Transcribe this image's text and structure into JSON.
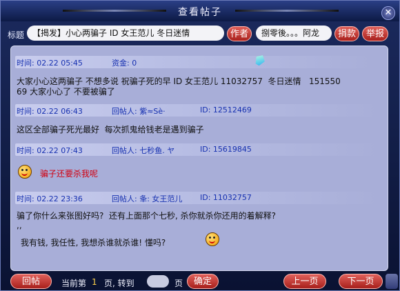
{
  "window": {
    "title": "查看帖子"
  },
  "header": {
    "title_label": "标题",
    "post_title": "【揭发】小心两骗子 ID 女王范儿  冬日迷情",
    "author_button": "作者",
    "author_name": "捌零後。。。阿龙",
    "donate_button": "捐款",
    "report_button": "举报"
  },
  "posts": [
    {
      "meta_time": "时间: 02.22 05:45",
      "meta_funds": "资金: 0",
      "lines": [
        "大家小心这两骗子 不想多说 祝骗子死的早 ID 女王范儿 11032757  冬日迷情   151550",
        "69 大家小心了 不要被骗了"
      ]
    },
    {
      "meta_time": "时间: 02.22 06:43",
      "meta_replier": "回帖人: 紫≈Sè·",
      "meta_id": "ID: 12512469",
      "lines": [
        "这区全部骗子死光最好  每次抓鬼给钱老是遇到骗子"
      ]
    },
    {
      "meta_time": "时间: 02.22 07:43",
      "meta_replier": "回帖人: 七秒鱼. ヤ",
      "meta_id": "ID: 15619845",
      "lines": [
        "骗子还要杀我呢"
      ]
    },
    {
      "meta_time": "时间: 02.22 23:36",
      "meta_replier": "回帖人: 夆: 女王范儿",
      "meta_id": "ID: 11032757",
      "lines": [
        "骗了你什么来张图好吗?  还有上面那个七秒, 杀你就杀你还用的着解释?",
        ",,",
        "我有钱, 我任性, 我想杀谁就杀谁! 懂吗?"
      ]
    }
  ],
  "footer": {
    "reply_button": "回帖",
    "current_prefix": "当前第",
    "current_page": "1",
    "page_goto": "页, 转到",
    "page_suffix": "页",
    "confirm_button": "确定",
    "prev_button": "上一页",
    "next_button": "下一页"
  },
  "colors": {
    "accent": "#d10010",
    "meta_text": "#1630b0",
    "panel": "#a8aed8"
  },
  "icons": [
    "close-icon",
    "crystal-icon",
    "smiley-icon"
  ]
}
